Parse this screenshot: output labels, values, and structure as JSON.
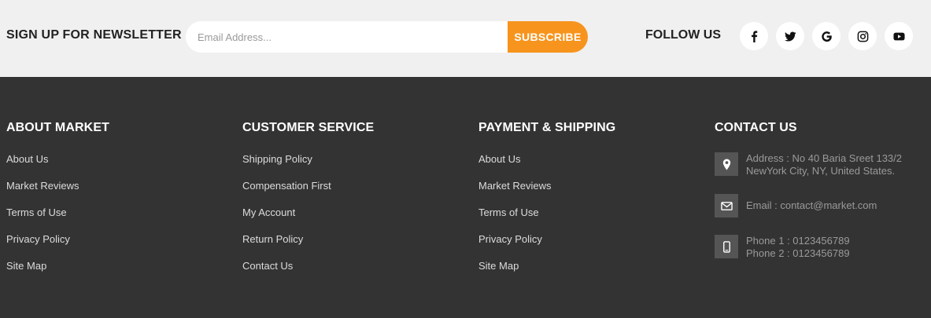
{
  "newsletter": {
    "title": "SIGN UP FOR NEWSLETTER",
    "email_placeholder": "Email Address...",
    "subscribe_label": "SUBSCRIBE",
    "accent_color": "#f7941d"
  },
  "follow": {
    "title": "FOLLOW US",
    "icons": [
      "facebook-icon",
      "twitter-icon",
      "google-icon",
      "instagram-icon",
      "youtube-icon"
    ]
  },
  "columns": [
    {
      "title": "ABOUT MARKET",
      "links": [
        "About Us",
        "Market Reviews",
        "Terms of Use",
        "Privacy Policy",
        "Site Map"
      ]
    },
    {
      "title": "CUSTOMER SERVICE",
      "links": [
        "Shipping Policy",
        "Compensation First",
        "My Account",
        "Return Policy",
        "Contact Us"
      ]
    },
    {
      "title": "PAYMENT & SHIPPING",
      "links": [
        "About Us",
        "Market Reviews",
        "Terms of Use",
        "Privacy Policy",
        "Site Map"
      ]
    }
  ],
  "contact": {
    "title": "CONTACT US",
    "address_line1": "Address : No 40 Baria Sreet 133/2",
    "address_line2": "NewYork City, NY, United States.",
    "email": "Email : contact@market.com",
    "phone1": "Phone 1 : 0123456789",
    "phone2": "Phone 2 : 0123456789",
    "icons": [
      "map-marker-icon",
      "envelope-icon",
      "mobile-phone-icon"
    ]
  },
  "colors": {
    "newsletter_bg": "#f0f0f0",
    "footer_bg": "#333333",
    "icon_box_bg": "#555555"
  }
}
